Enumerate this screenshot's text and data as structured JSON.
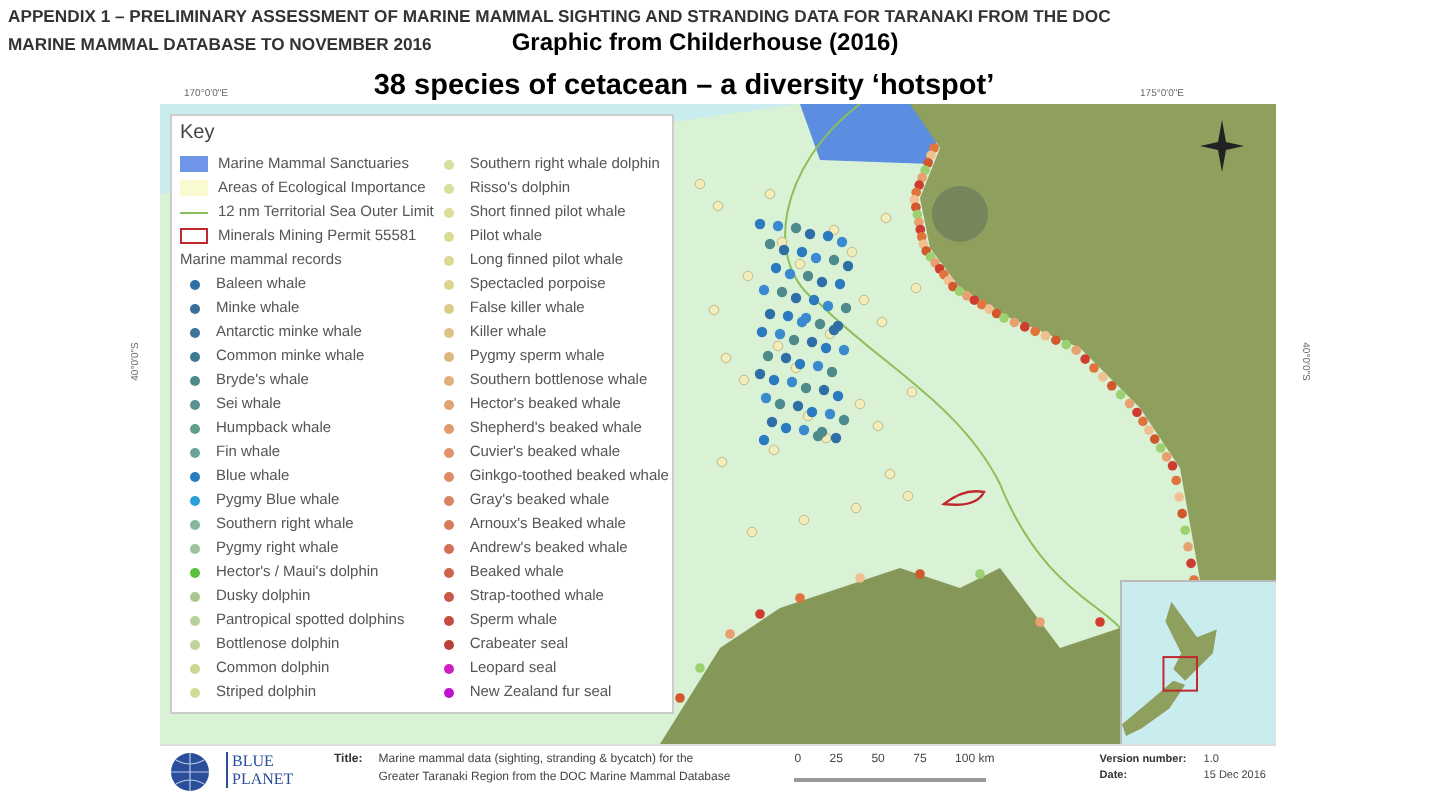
{
  "header": {
    "line_1": "APPENDIX 1 – PRELIMINARY ASSESSMENT OF MARINE MAMMAL SIGHTING AND STRANDING DATA FOR TARANAKI FROM THE DOC",
    "line_2": "MARINE MAMMAL DATABASE TO NOVEMBER 2016",
    "credit": "Graphic from Childerhouse (2016)"
  },
  "heading": "38 species of cetacean – a diversity ‘hotspot’",
  "map": {
    "top_coords": [
      "170°0'0\"E",
      "175°0'0\"E"
    ],
    "side_coords": [
      "40°0'0\"S",
      "40°0'0\"S"
    ],
    "key": {
      "title": "Key",
      "areas": [
        {
          "label": "Marine Mammal Sanctuaries",
          "kind": "fill"
        },
        {
          "label": "Areas of Ecological Importance",
          "kind": "tint"
        },
        {
          "label": "12 nm Territorial Sea Outer Limit",
          "kind": "line"
        },
        {
          "label": "Minerals Mining Permit 55581",
          "kind": "outline"
        }
      ],
      "records_heading": "Marine mammal records",
      "records_left": [
        {
          "label": "Baleen whale",
          "color": "#2f6fa8"
        },
        {
          "label": "Minke whale",
          "color": "#3a6f9a"
        },
        {
          "label": "Antarctic minke whale",
          "color": "#3d7396"
        },
        {
          "label": "Common minke whale",
          "color": "#3f7a93"
        },
        {
          "label": "Bryde's whale",
          "color": "#4c8a8c"
        },
        {
          "label": "Sei whale",
          "color": "#5a9490"
        },
        {
          "label": "Humpback whale",
          "color": "#62a08e"
        },
        {
          "label": "Fin whale",
          "color": "#6aa597"
        },
        {
          "label": "Blue whale",
          "color": "#2a7bc0"
        },
        {
          "label": "Pygmy Blue whale",
          "color": "#2aa0d8"
        },
        {
          "label": "Southern right whale",
          "color": "#88b89a"
        },
        {
          "label": "Pygmy right whale",
          "color": "#9cc39c"
        },
        {
          "label": "Hector's / Maui's dolphin",
          "color": "#5cc13a"
        },
        {
          "label": "Dusky dolphin",
          "color": "#a8c890"
        },
        {
          "label": "Pantropical spotted dolphins",
          "color": "#b8d09a"
        },
        {
          "label": "Bottlenose dolphin",
          "color": "#bed49c"
        },
        {
          "label": "Common dolphin",
          "color": "#c8d890"
        },
        {
          "label": "Striped dolphin",
          "color": "#d0dc98"
        }
      ],
      "records_right": [
        {
          "label": "Southern right whale dolphin",
          "color": "#d4e0a0"
        },
        {
          "label": "Risso's dolphin",
          "color": "#d8df9c"
        },
        {
          "label": "Short finned pilot whale",
          "color": "#dcde98"
        },
        {
          "label": "Pilot whale",
          "color": "#d8dc90"
        },
        {
          "label": "Long finned pilot whale",
          "color": "#dcd890"
        },
        {
          "label": "Spectacled porpoise",
          "color": "#dcd48c"
        },
        {
          "label": "False killer whale",
          "color": "#dccc88"
        },
        {
          "label": "Killer whale",
          "color": "#dcc484"
        },
        {
          "label": "Pygmy sperm whale",
          "color": "#dcb880"
        },
        {
          "label": "Southern bottlenose whale",
          "color": "#e0b07c"
        },
        {
          "label": "Hector's beaked whale",
          "color": "#e0a474"
        },
        {
          "label": "Shepherd's beaked whale",
          "color": "#e09c70"
        },
        {
          "label": "Cuvier's beaked whale",
          "color": "#e0946c"
        },
        {
          "label": "Ginkgo-toothed beaked whale",
          "color": "#dc8c68"
        },
        {
          "label": "Gray's beaked whale",
          "color": "#d88464"
        },
        {
          "label": "Arnoux's Beaked whale",
          "color": "#d47c5c"
        },
        {
          "label": "Andrew's beaked whale",
          "color": "#d07058"
        },
        {
          "label": "Beaked whale",
          "color": "#cc6450"
        },
        {
          "label": "Strap-toothed whale",
          "color": "#c85848"
        },
        {
          "label": "Sperm whale",
          "color": "#c44c40"
        },
        {
          "label": "Crabeater seal",
          "color": "#b84038"
        },
        {
          "label": "Leopard seal",
          "color": "#d020c0"
        },
        {
          "label": "New Zealand fur seal",
          "color": "#c010d0"
        }
      ]
    }
  },
  "footer": {
    "logo_line_1": "BLUE",
    "logo_line_2": "PLANET",
    "title_label": "Title:",
    "title_lines": [
      "Marine mammal data (sighting, stranding & bycatch) for the",
      "Greater Taranaki Region from the DOC Marine Mammal Database"
    ],
    "scale": [
      "0",
      "25",
      "50",
      "75",
      "100 km"
    ],
    "meta": [
      {
        "label": "Version number:",
        "value": "1.0"
      },
      {
        "label": "Date:",
        "value": "15 Dec 2016"
      }
    ]
  }
}
